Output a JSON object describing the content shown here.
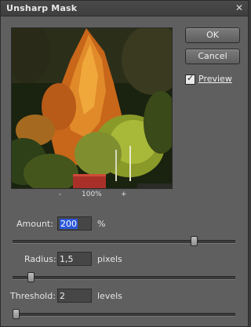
{
  "dialog": {
    "title": "Unsharp Mask",
    "close_icon": "close-icon"
  },
  "preview": {
    "zoom_out": "-",
    "zoom_level": "100%",
    "zoom_in": "+"
  },
  "buttons": {
    "ok": "OK",
    "cancel": "Cancel"
  },
  "preview_checkbox": {
    "label": "Preview",
    "checked": true,
    "mark": "✓"
  },
  "amount": {
    "label": "Amount:",
    "value": "200",
    "unit": "%",
    "slider_fraction": 0.82
  },
  "radius": {
    "label": "Radius:",
    "value": "1,5",
    "unit": "pixels",
    "slider_fraction": 0.08
  },
  "threshold": {
    "label": "Threshold:",
    "value": "2",
    "unit": "levels",
    "slider_fraction": 0.0
  }
}
